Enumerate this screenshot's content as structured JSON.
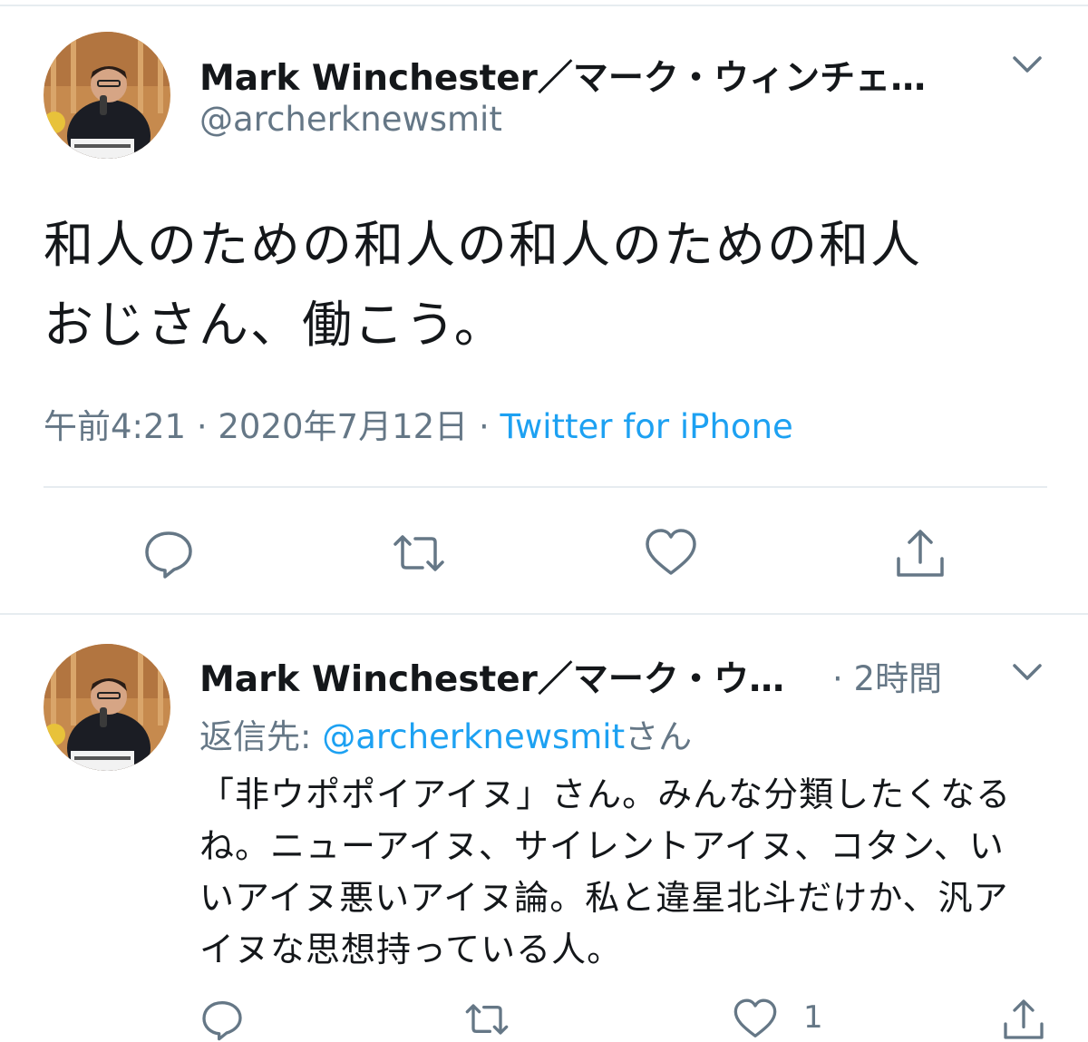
{
  "main_tweet": {
    "display_name": "Mark Winchester／マーク・ウィンチェ…",
    "handle": "@archerknewsmit",
    "text_line1": "和人のための和人の和人のための和人",
    "text_line2": "おじさん、働こう。",
    "time": "午前4:21",
    "separator": "·",
    "date": "2020年7月12日",
    "source": "Twitter for iPhone"
  },
  "reply_tweet": {
    "display_name": "Mark Winchester／マーク・ウ…",
    "time_ago": "· 2時間",
    "reply_label": "返信先:",
    "reply_mention": "@archerknewsmit",
    "reply_suffix": "さん",
    "body_line1": "「非ウポポイアイヌ」さん。みんな分類したくなる",
    "body_line2": "ね。ニューアイヌ、サイレントアイヌ、コタン、い",
    "body_line3": "いアイヌ悪いアイヌ論。私と違星北斗だけか、汎ア",
    "body_line4": "イヌな思想持っている人。",
    "like_count": "1"
  },
  "icons": {
    "reply": "reply-icon",
    "retweet": "retweet-icon",
    "like": "heart-icon",
    "share": "share-icon",
    "more": "chevron-down-icon"
  },
  "colors": {
    "text": "#14171a",
    "secondary": "#657786",
    "link": "#1da1f2",
    "divider": "#e6ecf0"
  }
}
